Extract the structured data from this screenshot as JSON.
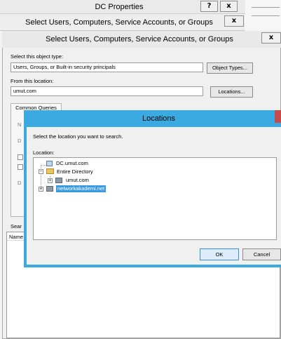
{
  "dc_properties": {
    "title": "DC Properties",
    "help_label": "?",
    "close_label": "x"
  },
  "select_dialog_back": {
    "title": "Select Users, Computers, Service Accounts, or Groups",
    "close_label": "x"
  },
  "select_dialog": {
    "title": "Select Users, Computers, Service Accounts, or Groups",
    "close_label": "x",
    "object_type_label": "Select this object type:",
    "object_type_value": "Users, Groups, or Built-in security principals",
    "object_types_button": "Object Types...",
    "location_label": "From this location:",
    "location_value": "umut.com",
    "locations_button": "Locations...",
    "tab_common_queries": "Common Queries",
    "ghost_n": "N",
    "ghost_d1": "D",
    "ghost_d2": "D",
    "search_results_label": "Sear",
    "column_name": "Name"
  },
  "locations": {
    "title": "Locations",
    "instruction": "Select the location you want to search.",
    "location_label": "Location:",
    "tree": {
      "root_dc": "DC.umut.com",
      "entire_directory": "Entire Directory",
      "domain_umut": "umut.com",
      "domain_networkakademi": "networkakademi.net",
      "expander_plus": "+",
      "expander_minus": "−"
    },
    "ok_button": "OK",
    "cancel_button": "Cancel"
  },
  "colors": {
    "dialog_accent_border": "#3aaae0",
    "selection_highlight": "#3c9bdf",
    "ok_button_fill": "#dcecfa"
  },
  "icons": [
    "computer-icon",
    "directory-icon",
    "domain-icon",
    "expand-icon",
    "collapse-icon"
  ]
}
